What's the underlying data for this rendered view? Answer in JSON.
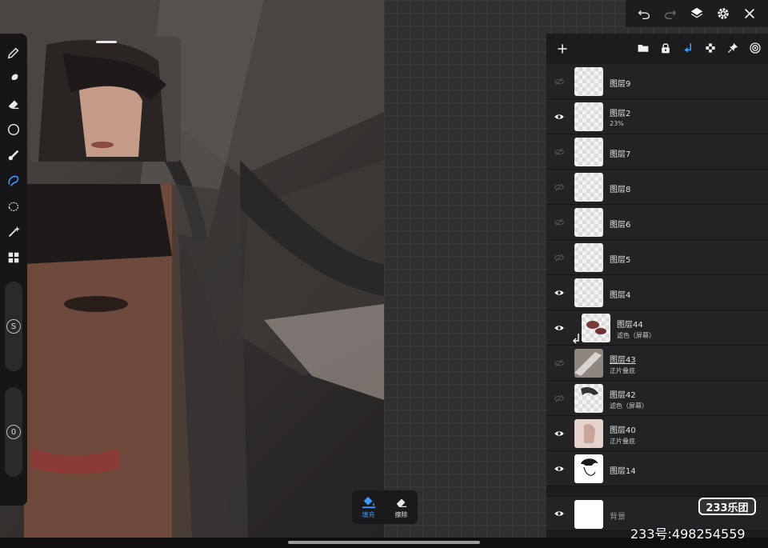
{
  "colors": {
    "accent": "#3b9aff",
    "panel": "#1c1c1e",
    "row": "#232325"
  },
  "reference": {
    "handle": "drag-handle"
  },
  "toolbar": {
    "slider_top_label": "S",
    "slider_bottom_label": "0",
    "tools": [
      "brush-icon",
      "smudge-icon",
      "eraser-icon",
      "selection-circle-icon",
      "adjust-icon",
      "lasso-icon",
      "select-area-icon",
      "magic-wand-icon",
      "gallery-icon"
    ]
  },
  "top_controls": [
    "undo-icon",
    "redo-icon",
    "layers-icon",
    "settings-icon",
    "close-icon"
  ],
  "layers_toolbar": [
    "folder-icon",
    "lock-icon",
    "clip-icon",
    "transparency-icon",
    "pin-icon",
    "target-icon"
  ],
  "layers": [
    {
      "name": "图层9",
      "sub": "",
      "visible": false
    },
    {
      "name": "图层2",
      "sub": "23%",
      "visible": true
    },
    {
      "name": "图层7",
      "sub": "",
      "visible": false
    },
    {
      "name": "图层8",
      "sub": "",
      "visible": false
    },
    {
      "name": "图层6",
      "sub": "",
      "visible": false
    },
    {
      "name": "图层5",
      "sub": "",
      "visible": false
    },
    {
      "name": "图层4",
      "sub": "",
      "visible": true
    },
    {
      "name": "图层44",
      "sub": "滤色（屏幕）",
      "visible": true,
      "clipped": true
    },
    {
      "name": "图层43",
      "sub": "正片叠底",
      "visible": false
    },
    {
      "name": "图层42",
      "sub": "滤色（屏幕）",
      "visible": false
    },
    {
      "name": "图层40",
      "sub": "正片叠底",
      "visible": true
    },
    {
      "name": "图层14",
      "sub": "",
      "visible": true
    },
    {
      "name": "背景",
      "sub": "",
      "visible": true
    }
  ],
  "fill_bar": {
    "fill_label": "填充",
    "erase_label": "擦除"
  },
  "watermark": {
    "badge": "233乐团",
    "id_text": "233号:498254559"
  }
}
